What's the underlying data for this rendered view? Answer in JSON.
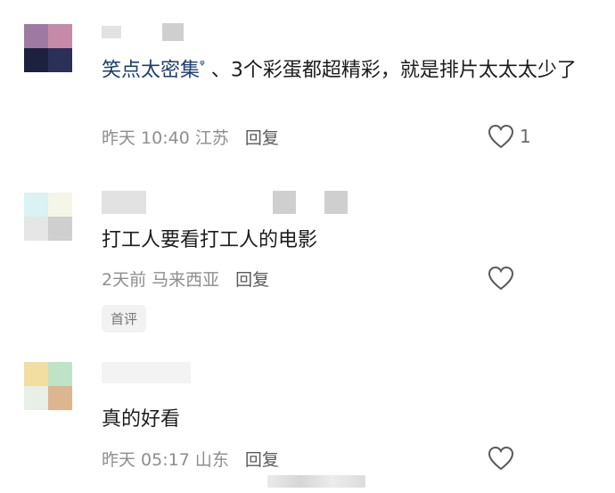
{
  "comments": [
    {
      "name": "笑点太密集",
      "name_suffix": "ᵠ",
      "text_main": "、3个彩蛋都超精彩，就是排片太太太少了",
      "time": "昨天 10:40",
      "location": "江苏",
      "reply_label": "回复",
      "like_count": "1",
      "avatar_colors": [
        "#9e7aa3",
        "#c58aa8",
        "#1c2140",
        "#2b3058"
      ]
    },
    {
      "text_main": "打工人要看打工人的电影",
      "time": "2天前",
      "location": "马来西亚",
      "reply_label": "回复",
      "badge": "首评",
      "avatar_colors": [
        "#d9f2f4",
        "#f5f6e6",
        "#e6e6e6",
        "#cfcfcf"
      ]
    },
    {
      "text_main": "真的好看",
      "time": "昨天 05:17",
      "location": "山东",
      "reply_label": "回复",
      "avatar_colors": [
        "#f1dea0",
        "#bfe3c6",
        "#e8efe6",
        "#ddb58f"
      ]
    }
  ],
  "icons": {
    "like": "heart-outline-icon"
  }
}
